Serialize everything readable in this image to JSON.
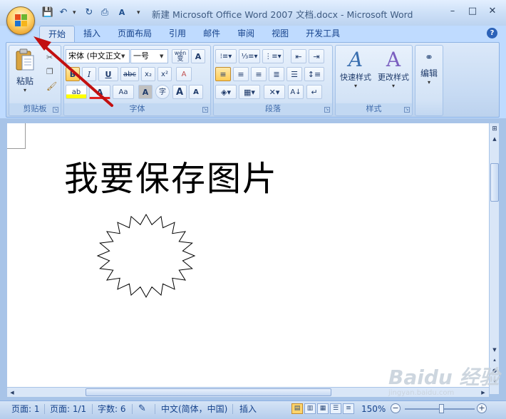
{
  "window": {
    "title": "新建 Microsoft Office Word 2007 文档.docx - Microsoft Word",
    "controls": {
      "minimize": "–",
      "maximize": "□",
      "close": "✕"
    }
  },
  "quick_access": {
    "save_icon": "save-icon",
    "undo_icon": "undo-icon",
    "redo_icon": "redo-icon",
    "print_preview_icon": "print-preview-icon",
    "spelling_icon": "spelling-check-icon"
  },
  "tabs": [
    {
      "label": "开始",
      "active": true
    },
    {
      "label": "插入",
      "active": false
    },
    {
      "label": "页面布局",
      "active": false
    },
    {
      "label": "引用",
      "active": false
    },
    {
      "label": "邮件",
      "active": false
    },
    {
      "label": "审阅",
      "active": false
    },
    {
      "label": "视图",
      "active": false
    },
    {
      "label": "开发工具",
      "active": false
    }
  ],
  "ribbon": {
    "clipboard": {
      "paste_label": "粘贴",
      "group_label": "剪贴板"
    },
    "font": {
      "font_name": "宋体 (中文正文",
      "font_size": "一号",
      "wen_label": "wén",
      "wen_char": "变",
      "char_border": "A",
      "bold": "B",
      "italic": "I",
      "underline": "U",
      "strike": "abc",
      "subscript": "x₂",
      "superscript": "x²",
      "clear_format": "A",
      "highlight": "ab",
      "font_color": "A",
      "change_case": "Aa",
      "char_shading": "A",
      "enclose": "字",
      "grow": "A",
      "shrink": "A",
      "group_label": "字体"
    },
    "paragraph": {
      "group_label": "段落"
    },
    "styles": {
      "quick_styles_label": "快速样式",
      "change_styles_label": "更改样式",
      "group_label": "样式"
    },
    "editing": {
      "label": "编辑"
    }
  },
  "document": {
    "text": "我要保存图片"
  },
  "status_bar": {
    "page": "页面: 1",
    "pages": "页面: 1/1",
    "word_count": "字数: 6",
    "language": "中文(简体，中国)",
    "insert_mode": "插入",
    "zoom": "150%"
  },
  "watermark": {
    "big": "Baidu 经验",
    "small": "jingyan.baidu.com"
  },
  "colors": {
    "accent_arrow": "#c21010",
    "ribbon_bg": "#dbe8f9",
    "highlight_yellow": "#ffd56b"
  }
}
